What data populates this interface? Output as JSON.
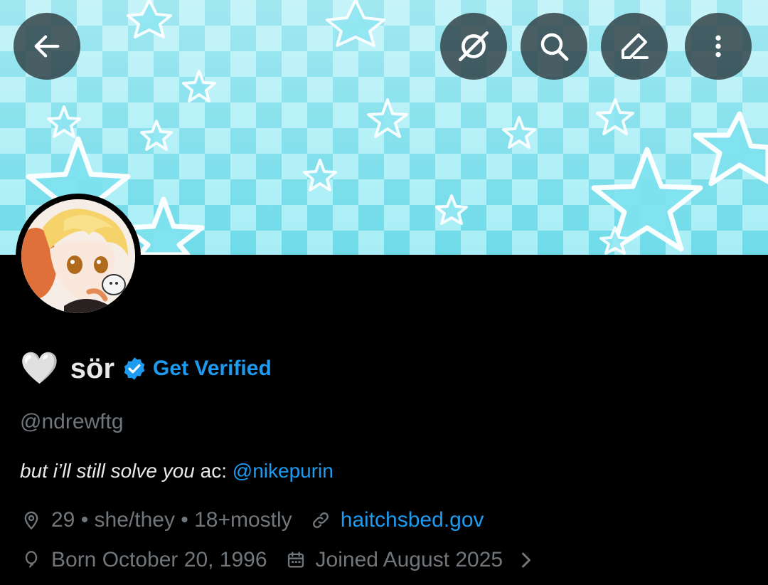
{
  "header": {
    "back_icon": "arrow-left-icon",
    "grok_icon": "grok-icon",
    "search_icon": "search-icon",
    "edit_icon": "edit-icon",
    "more_icon": "more-vertical-icon"
  },
  "profile": {
    "heart": "🤍",
    "display_name": "sör",
    "get_verified": "Get Verified",
    "handle": "@ndrewftg",
    "bio_italic": "but i’ll still solve you",
    "bio_plain": " ac: ",
    "bio_mention": "@nikepurin",
    "location": "29 • she/they • 18+mostly",
    "website": "haitchsbed.gov",
    "born": "Born October 20, 1996",
    "joined": "Joined August 2025"
  },
  "colors": {
    "background": "#000000",
    "accent": "#1d9bf0",
    "secondary_text": "#71767b",
    "primary_text": "#e7e9ea",
    "banner": "#8fe6f2"
  }
}
